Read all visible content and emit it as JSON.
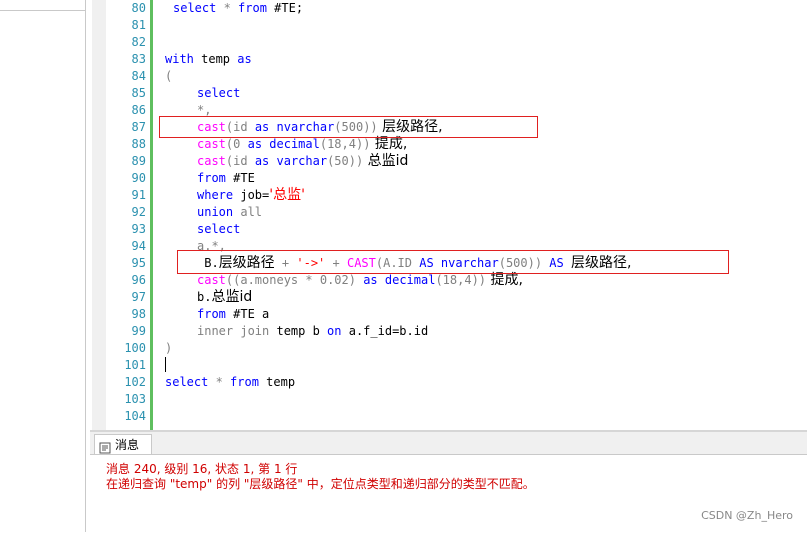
{
  "editor": {
    "line_numbers": [
      "80",
      "81",
      "82",
      "83",
      "84",
      "85",
      "86",
      "87",
      "88",
      "89",
      "90",
      "91",
      "92",
      "93",
      "94",
      "95",
      "96",
      "97",
      "98",
      "99",
      "100",
      "101",
      "102",
      "103",
      "104"
    ],
    "lines": {
      "l80": {
        "a": "select",
        "b": " * ",
        "c": "from",
        "d": " #TE;"
      },
      "l83": {
        "a": "with",
        "b": " temp ",
        "c": "as"
      },
      "l84": {
        "a": "("
      },
      "l85": {
        "a": "select"
      },
      "l86": {
        "a": "*,"
      },
      "l87": {
        "a": "cast",
        "b": "(id ",
        "c": "as",
        "d": " nvarchar",
        "e": "(500))",
        "f": " 层级路径,"
      },
      "l88": {
        "a": "cast",
        "b": "(0 ",
        "c": "as",
        "d": " decimal",
        "e": "(18,4))",
        "f": " 提成,"
      },
      "l89": {
        "a": "cast",
        "b": "(id ",
        "c": "as",
        "d": " varchar",
        "e": "(50))",
        "f": " 总监id"
      },
      "l90": {
        "a": "from",
        "b": " #TE"
      },
      "l91": {
        "a": "where",
        "b": " job=",
        "c": "'总监'"
      },
      "l92": {
        "a": "union",
        "b": " all"
      },
      "l93": {
        "a": "select"
      },
      "l94": {
        "a": "a.*,"
      },
      "l95": {
        "a": " B.",
        "b": "层级路径",
        "c": " + ",
        "d": "'->'",
        "e": " + ",
        "f": "CAST",
        "g": "(A.ID ",
        "h": "AS",
        "i": " nvarchar",
        "j": "(500))",
        "k": " AS ",
        "l": "层级路径,"
      },
      "l96": {
        "a": "cast",
        "b": "((a.moneys ",
        "c": "*",
        "d": " 0.02) ",
        "e": "as",
        "f": " decimal",
        "g": "(18,4))",
        "h": " 提成,"
      },
      "l97": {
        "a": "b.",
        "b": "总监id"
      },
      "l98": {
        "a": "from",
        "b": " #TE a"
      },
      "l99": {
        "a": "inner join",
        "b": " temp b ",
        "c": "on",
        "d": " a.f_id=b.id"
      },
      "l100": {
        "a": ")"
      },
      "l102": {
        "a": "select",
        "b": " * ",
        "c": "from",
        "d": " temp"
      }
    }
  },
  "messages": {
    "tab_label": "消息",
    "line1": "消息 240, 级别 16, 状态 1, 第 1 行",
    "line2": "在递归查询 \"temp\" 的列 \"层级路径\" 中，定位点类型和递归部分的类型不匹配。"
  },
  "watermark": "CSDN @Zh_Hero",
  "colors": {
    "keyword": "#0000ff",
    "function": "#ff00ff",
    "string": "#ff0000",
    "line_number": "#2b91af",
    "error": "#d00000",
    "highlight_box": "#e02020"
  }
}
